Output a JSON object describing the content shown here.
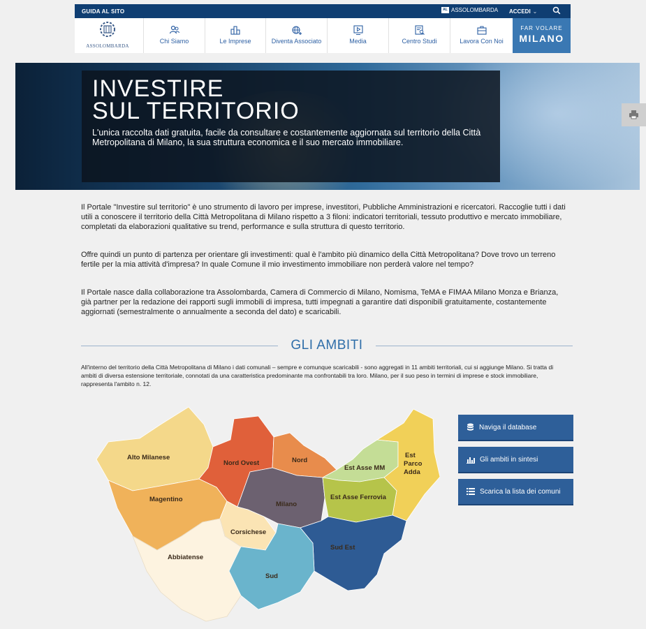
{
  "topbar": {
    "guide": "GUIDA AL SITO",
    "brand": "ASSOLOMBARDA",
    "brand_mini": "AL",
    "login": "ACCEDI",
    "login_chev": "⌄"
  },
  "nav": {
    "logo_text": "ASSOLOMBARDA",
    "items": [
      {
        "label": "Chi Siamo",
        "icon": "people-icon"
      },
      {
        "label": "Le Imprese",
        "icon": "buildings-icon"
      },
      {
        "label": "Diventa Associato",
        "icon": "globe-plus-icon"
      },
      {
        "label": "Media",
        "icon": "play-icon"
      },
      {
        "label": "Centro Studi",
        "icon": "chart-search-icon"
      },
      {
        "label": "Lavora Con Noi",
        "icon": "briefcase-icon"
      }
    ],
    "fvm_top": "FAR VOLARE",
    "fvm_bottom": "MILANO"
  },
  "hero": {
    "title_line1": "INVESTIRE",
    "title_line2": "SUL TERRITORIO",
    "subtitle": "L'unica raccolta dati gratuita, facile da consultare e costantemente aggiornata sul territorio della Città Metropolitana di Milano, la sua struttura economica e il suo mercato immobiliare."
  },
  "intro": {
    "p1": "Il Portale \"Investire sul territorio\" è uno strumento di lavoro per imprese, investitori, Pubbliche Amministrazioni e ricercatori. Raccoglie tutti i dati utili a conoscere il territorio della Città Metropolitana di Milano rispetto a 3 filoni: indicatori territoriali, tessuto produttivo e mercato immobiliare, completati da elaborazioni qualitative su trend, performance e sulla struttura di questo territorio.",
    "p2": "Offre quindi un punto di partenza per orientare gli investimenti: qual è l'ambito più dinamico della Città Metropolitana? Dove trovo un terreno fertile per la mia attività d'impresa? In quale Comune il mio investimento immobiliare non perderà valore nel tempo?",
    "p3": "Il Portale nasce dalla collaborazione tra Assolombarda, Camera di Commercio di Milano, Nomisma, TeMA e FIMAA Milano Monza e Brianza, già partner per la redazione dei rapporti sugli immobili di impresa, tutti impegnati a garantire dati disponibili gratuitamente, costantemente aggiornati (semestralmente o annualmente a seconda del dato) e scaricabili."
  },
  "ambiti": {
    "title": "GLI AMBITI",
    "text": "All'interno del territorio della Città Metropolitana di Milano i dati comunali – sempre e comunque scaricabili - sono aggregati in 11 ambiti territoriali, cui si aggiunge Milano. Si tratta di ambiti di diversa estensione territoriale, connotati da una caratteristica predominante ma confrontabili tra loro. Milano, per il suo peso in termini di imprese e stock immobiliare, rappresenta l'ambito n. 12.",
    "regions": {
      "alto_milanese": "Alto Milanese",
      "nord_ovest": "Nord Ovest",
      "nord": "Nord",
      "est_asse_mm": "Est Asse MM",
      "est_parco_adda_1": "Est",
      "est_parco_adda_2": "Parco",
      "est_parco_adda_3": "Adda",
      "magentino": "Magentino",
      "milano": "Milano",
      "est_asse_ferrovia": "Est Asse Ferrovia",
      "corsichese": "Corsichese",
      "abbiatense": "Abbiatense",
      "sud_est": "Sud Est",
      "sud": "Sud"
    },
    "colors": {
      "alto_milanese": "#f4d88a",
      "nord_ovest": "#e0603a",
      "nord": "#e88c4c",
      "est_asse_mm": "#c4dd96",
      "est_parco_adda": "#f1d058",
      "magentino": "#f0b25a",
      "milano": "#6c6170",
      "est_asse_ferrovia": "#b6c44a",
      "corsichese": "#fbe4b4",
      "abbiatense": "#fdf3e0",
      "sud_est": "#2e5b94",
      "sud": "#6ab4cc"
    }
  },
  "buttons": [
    {
      "label": "Naviga il database",
      "icon": "database-icon"
    },
    {
      "label": "Gli ambiti in sintesi",
      "icon": "bar-chart-icon"
    },
    {
      "label": "Scarica la lista dei comuni",
      "icon": "list-icon"
    }
  ]
}
